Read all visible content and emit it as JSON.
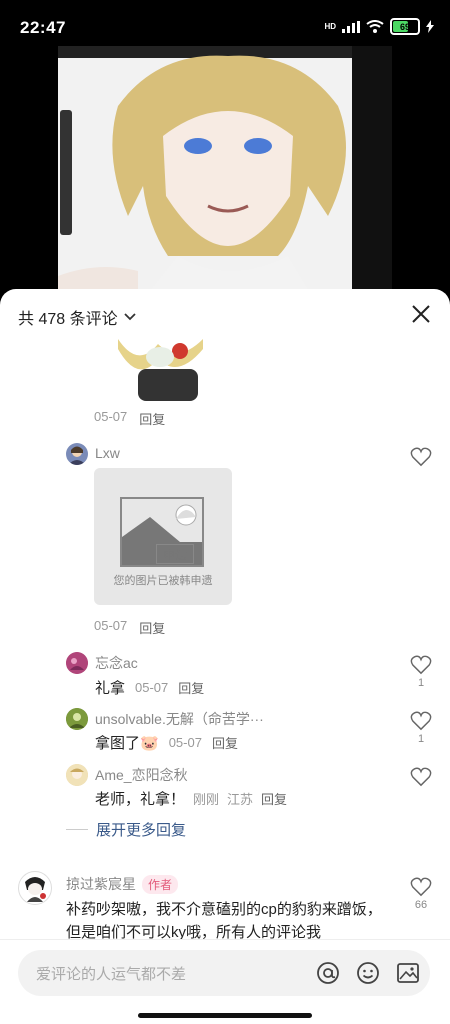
{
  "status_bar": {
    "time": "22:47",
    "network": "HD",
    "battery": "69",
    "battery_level": 0.69
  },
  "header": {
    "count_text": "共 478 条评论"
  },
  "comments": [
    {
      "date": "05-07",
      "reply": "回复"
    },
    {
      "user": "Lxw",
      "image_notice": "您的图片已被韩申遗",
      "stamp": "申遗",
      "date": "05-07",
      "reply": "回复"
    }
  ],
  "replies": [
    {
      "user": "忘念ac",
      "text": "礼拿",
      "date": "05-07",
      "reply": "回复",
      "likes": "1"
    },
    {
      "user": "unsolvable.无解（命苦学···",
      "text": "拿图了",
      "emoji": "🐷",
      "date": "05-07",
      "reply": "回复",
      "likes": "1"
    },
    {
      "user": "Ame_恋阳念秋",
      "text": "老师，礼拿！",
      "date": "刚刚",
      "location": "江苏",
      "reply": "回复"
    }
  ],
  "expand": {
    "label": "展开更多回复"
  },
  "author_comment": {
    "user": "掠过紫宸星",
    "tag": "作者",
    "text": "补药吵架嗷，我不介意磕别的cp的豹豹来蹭饭，但是咱们不可以ky哦，所有人的评论我",
    "likes": "66"
  },
  "composer": {
    "placeholder": "爱评论的人运气都不差"
  },
  "colors": {
    "accent_link": "#3a5a8a",
    "author_tag": "#e35a7b",
    "battery": "#4cd964"
  }
}
